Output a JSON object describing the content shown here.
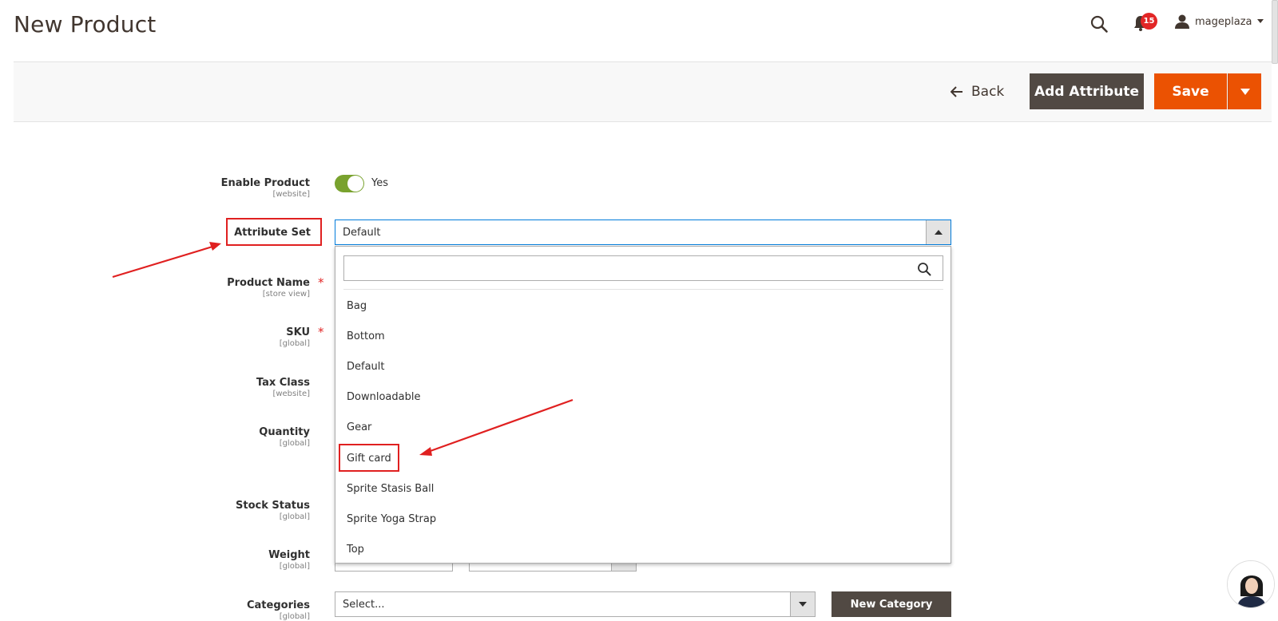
{
  "header": {
    "title": "New Product",
    "notification_count": "15",
    "username": "mageplaza"
  },
  "actions": {
    "back_label": "Back",
    "add_attribute_label": "Add Attribute",
    "save_label": "Save"
  },
  "form": {
    "enable_product": {
      "label": "Enable Product",
      "scope": "[website]",
      "value": "Yes"
    },
    "attribute_set": {
      "label": "Attribute Set",
      "value": "Default"
    },
    "product_name": {
      "label": "Product Name",
      "scope": "[store view]"
    },
    "sku": {
      "label": "SKU",
      "scope": "[global]"
    },
    "tax_class": {
      "label": "Tax Class",
      "scope": "[website]"
    },
    "quantity": {
      "label": "Quantity",
      "scope": "[global]"
    },
    "stock_status": {
      "label": "Stock Status",
      "scope": "[global]"
    },
    "weight": {
      "label": "Weight",
      "scope": "[global]"
    },
    "categories": {
      "label": "Categories",
      "scope": "[global]",
      "placeholder": "Select...",
      "new_category_label": "New Category"
    }
  },
  "dropdown": {
    "search_value": "",
    "options": [
      "Bag",
      "Bottom",
      "Default",
      "Downloadable",
      "Gear",
      "Gift card",
      "Sprite Stasis Ball",
      "Sprite Yoga Strap",
      "Top"
    ]
  },
  "colors": {
    "primary_button": "#514943",
    "save_button": "#eb5202",
    "toggle_on": "#79a22e",
    "focus_border": "#007bdb",
    "annotation": "#e02020"
  }
}
